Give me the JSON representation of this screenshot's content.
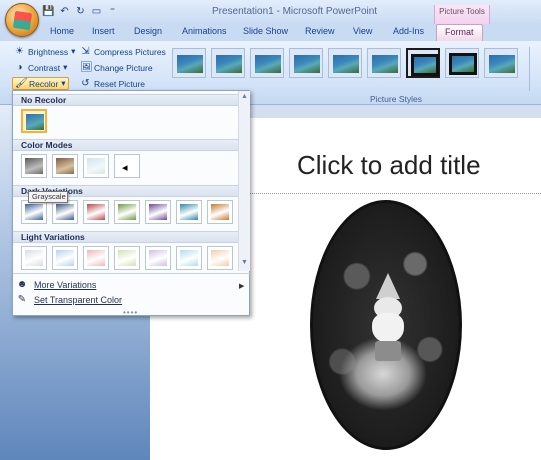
{
  "window": {
    "title": "Presentation1 - Microsoft PowerPoint",
    "contextual_tools": "Picture Tools"
  },
  "tabs": [
    {
      "label": "Home"
    },
    {
      "label": "Insert"
    },
    {
      "label": "Design"
    },
    {
      "label": "Animations"
    },
    {
      "label": "Slide Show"
    },
    {
      "label": "Review"
    },
    {
      "label": "View"
    },
    {
      "label": "Add-Ins"
    },
    {
      "label": "Format",
      "active": true
    }
  ],
  "adjust": {
    "brightness": "Brightness",
    "contrast": "Contrast",
    "recolor": "Recolor",
    "compress": "Compress Pictures",
    "change": "Change Picture",
    "reset": "Reset Picture"
  },
  "picture_styles": {
    "group_label": "Picture Styles"
  },
  "slide": {
    "title_placeholder": "Click to add title"
  },
  "recolor_menu": {
    "no_recolor": "No Recolor",
    "color_modes": "Color Modes",
    "dark_variations": "Dark Variations",
    "light_variations": "Light Variations",
    "more_variations": "More Variations",
    "set_transparent": "Set Transparent Color",
    "tooltip": "Grayscale",
    "dark_colors": [
      "#3b5f9a",
      "#3d5b8c",
      "#b94a4a",
      "#6f9a3f",
      "#6b4a97",
      "#2f89a6",
      "#c77a2f"
    ],
    "light_colors": [
      "#d9dde3",
      "#b9d1ee",
      "#efb7b7",
      "#cfe3b3",
      "#cfc1e3",
      "#b1dde9",
      "#f1cda7"
    ]
  },
  "colors": {
    "ribbon_bg": "#d6e5f8",
    "ribbon_text": "#15428b",
    "contextual_tab": "#f3d2ee",
    "selection": "#f0b43c"
  }
}
